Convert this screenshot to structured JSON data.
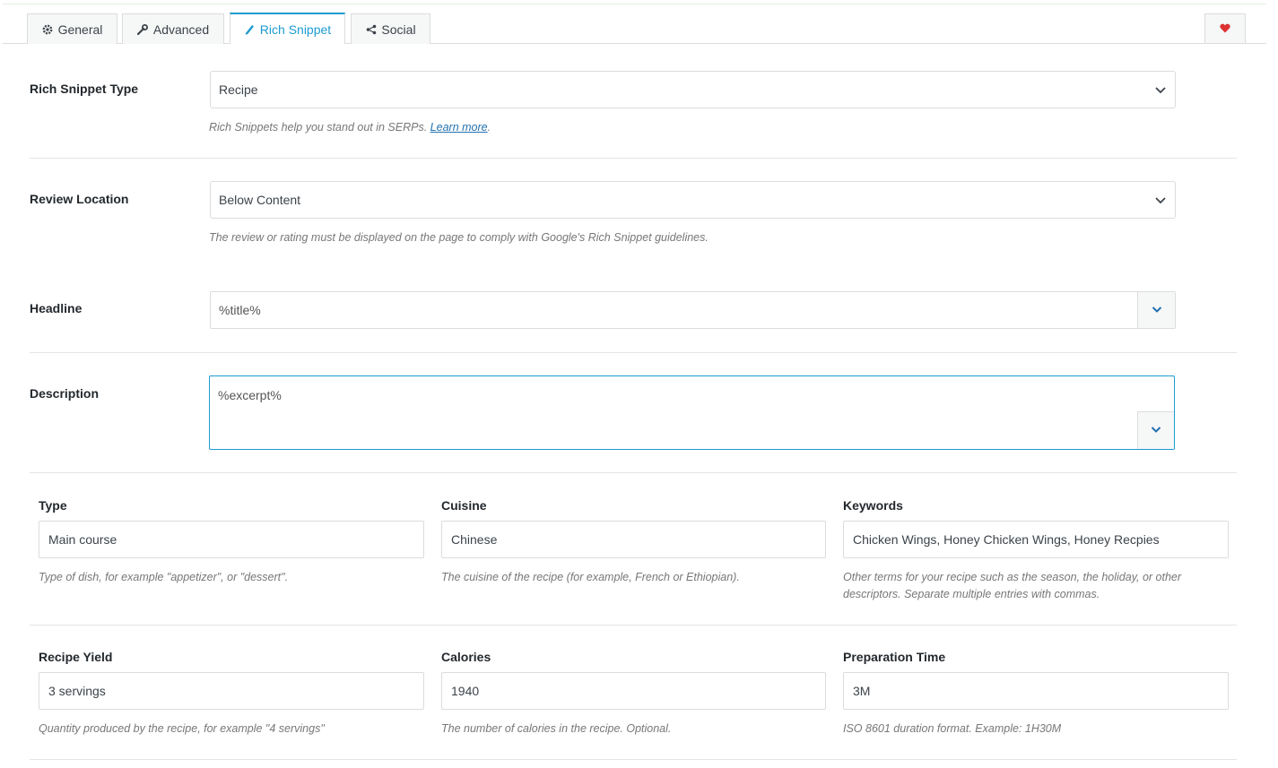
{
  "tabs": [
    {
      "label": "General",
      "icon": "gear-icon",
      "active": false
    },
    {
      "label": "Advanced",
      "icon": "wrench-icon",
      "active": false
    },
    {
      "label": "Rich Snippet",
      "icon": "pencil-icon",
      "active": true
    },
    {
      "label": "Social",
      "icon": "share-icon",
      "active": false
    }
  ],
  "heart_button": {
    "icon": "heart-icon",
    "color": "#dc3232"
  },
  "colors": {
    "accent": "#1e9bd0",
    "link": "#2271b1"
  },
  "rich_snippet_type": {
    "label": "Rich Snippet Type",
    "value": "Recipe",
    "help_prefix": "Rich Snippets help you stand out in SERPs. ",
    "help_link": "Learn more",
    "help_suffix": "."
  },
  "review_location": {
    "label": "Review Location",
    "value": "Below Content",
    "help": "The review or rating must be displayed on the page to comply with Google's Rich Snippet guidelines."
  },
  "headline": {
    "label": "Headline",
    "value": "%title%"
  },
  "description": {
    "label": "Description",
    "value": "%excerpt%"
  },
  "recipe_fields_row1": [
    {
      "label": "Type",
      "value": "Main course",
      "help": "Type of dish, for example \"appetizer\", or \"dessert\"."
    },
    {
      "label": "Cuisine",
      "value": "Chinese",
      "help": "The cuisine of the recipe (for example, French or Ethiopian)."
    },
    {
      "label": "Keywords",
      "value": "Chicken Wings, Honey Chicken Wings, Honey Recpies",
      "help": "Other terms for your recipe such as the season, the holiday, or other descriptors. Separate multiple entries with commas."
    }
  ],
  "recipe_fields_row2": [
    {
      "label": "Recipe Yield",
      "value": "3 servings",
      "help": "Quantity produced by the recipe, for example \"4 servings\""
    },
    {
      "label": "Calories",
      "value": "1940",
      "help": "The number of calories in the recipe. Optional."
    },
    {
      "label": "Preparation Time",
      "value": "3M",
      "help": "ISO 8601 duration format. Example: 1H30M"
    }
  ]
}
